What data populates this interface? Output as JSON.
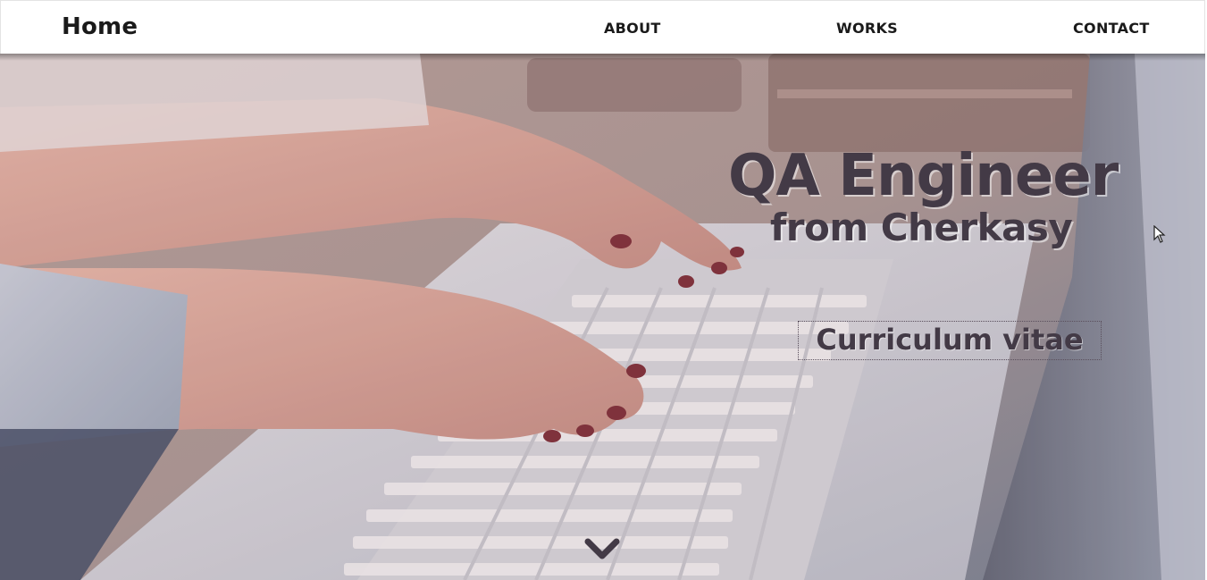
{
  "navbar": {
    "brand": "Home",
    "links": [
      {
        "label": "ABOUT"
      },
      {
        "label": "WORKS"
      },
      {
        "label": "CONTACT"
      }
    ]
  },
  "hero": {
    "title": "QA Engineer",
    "subtitle": "from Cherkasy",
    "cv_label": "Curriculum vitae",
    "background": "photo-hands-typing-on-laptop",
    "scroll_icon": "chevron-down-icon"
  },
  "colors": {
    "navbar_bg": "#ffffff",
    "nav_text": "#1a1a1a",
    "hero_text": "#433a46"
  }
}
